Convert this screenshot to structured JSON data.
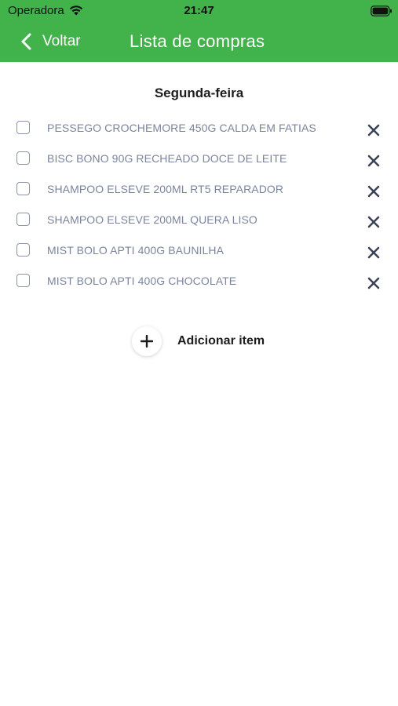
{
  "status_bar": {
    "carrier": "Operadora",
    "time": "21:47",
    "wifi_icon": "wifi-icon",
    "battery_icon": "battery-icon"
  },
  "header": {
    "back_label": "Voltar",
    "back_icon": "chevron-left-icon",
    "title": "Lista de compras",
    "background_color": "#42b24b"
  },
  "day_title": "Segunda-feira",
  "items": [
    {
      "label": "PESSEGO CROCHEMORE 450G CALDA EM FATIAS",
      "checked": false
    },
    {
      "label": "BISC BONO 90G RECHEADO DOCE DE LEITE",
      "checked": false
    },
    {
      "label": "SHAMPOO ELSEVE 200ML RT5 REPARADOR",
      "checked": false
    },
    {
      "label": "SHAMPOO ELSEVE 200ML QUERA LISO",
      "checked": false
    },
    {
      "label": "MIST BOLO APTI 400G BAUNILHA",
      "checked": false
    },
    {
      "label": "MIST BOLO APTI 400G CHOCOLATE",
      "checked": false
    }
  ],
  "add_item": {
    "label": "Adicionar item",
    "icon": "plus-icon"
  }
}
